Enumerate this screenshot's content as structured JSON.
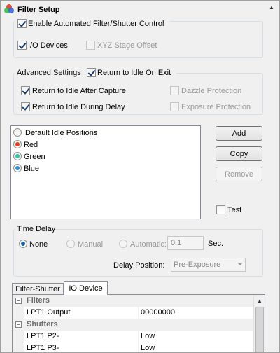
{
  "header": {
    "title": "Filter Setup",
    "icon": "rgb-circles-icon"
  },
  "top_group": {
    "enable_auto": {
      "label": "Enable Automated Filter/Shutter Control",
      "checked": true
    },
    "io_devices": {
      "label": "I/O Devices",
      "checked": true
    },
    "xyz_offset": {
      "label": "XYZ Stage Offset",
      "checked": false,
      "disabled": true
    }
  },
  "advanced": {
    "title": "Advanced Settings",
    "return_on_exit": {
      "label": "Return to Idle On Exit",
      "checked": true
    },
    "after_capture": {
      "label": "Return to Idle After Capture",
      "checked": true
    },
    "during_delay": {
      "label": "Return to Idle During Delay",
      "checked": true
    },
    "dazzle": {
      "label": "Dazzle Protection",
      "checked": false,
      "disabled": true
    },
    "exposure": {
      "label": "Exposure Protection",
      "checked": false,
      "disabled": true
    }
  },
  "positions": [
    {
      "label": "Default Idle Positions",
      "color": "#ffffff"
    },
    {
      "label": "Red",
      "color": "#e53b1f"
    },
    {
      "label": "Green",
      "color": "#33c8a8"
    },
    {
      "label": "Blue",
      "color": "#2f8fd8"
    }
  ],
  "buttons": {
    "add": "Add",
    "copy": "Copy",
    "remove": "Remove"
  },
  "test": {
    "label": "Test",
    "checked": false
  },
  "time_delay": {
    "title": "Time Delay",
    "none": "None",
    "manual": "Manual",
    "automatic": "Automatic:",
    "value": "0.1",
    "unit": "Sec.",
    "delay_position_label": "Delay Position:",
    "delay_position_value": "Pre-Exposure",
    "selected": "None"
  },
  "tabs": [
    {
      "label": "Filter-Shutter",
      "active": false
    },
    {
      "label": "IO Device",
      "active": true
    }
  ],
  "grid": {
    "filters_cat": "Filters",
    "lpt1_output_name": "LPT1 Output",
    "lpt1_output_value": "00000000",
    "shutters_cat": "Shutters",
    "lpt1_p2_name": "LPT1 P2-",
    "lpt1_p2_value": "Low",
    "lpt1_p3_name": "LPT1 P3-",
    "lpt1_p3_value": "Low"
  }
}
